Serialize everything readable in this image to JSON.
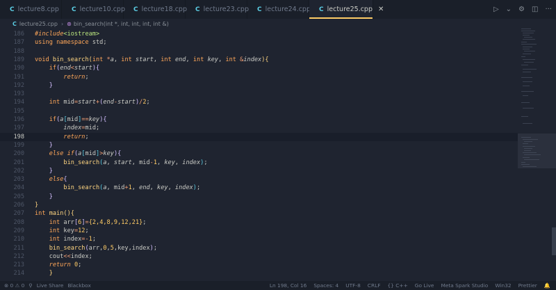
{
  "tabs": [
    {
      "label": "lecture8.cpp",
      "icon": "C"
    },
    {
      "label": "lecture10.cpp",
      "icon": "C"
    },
    {
      "label": "lecture18.cpp",
      "icon": "C"
    },
    {
      "label": "lecture23.cpp",
      "icon": "C"
    },
    {
      "label": "lecture24.cpp",
      "icon": "C"
    },
    {
      "label": "lecture25.cpp",
      "icon": "C",
      "active": true
    }
  ],
  "tab_close": "✕",
  "tab_actions": {
    "run": "▷",
    "run_menu": "⌄",
    "settings": "⚙",
    "split": "◫",
    "more": "···"
  },
  "breadcrumb": {
    "file": "lecture25.cpp",
    "symbol": "bin_search(int *, int, int, int, int &)"
  },
  "editor": {
    "current_line": 198,
    "lines": [
      {
        "n": "186"
      },
      {
        "n": "187"
      },
      {
        "n": "188"
      },
      {
        "n": "189"
      },
      {
        "n": "190"
      },
      {
        "n": "191"
      },
      {
        "n": "192"
      },
      {
        "n": "193"
      },
      {
        "n": "194"
      },
      {
        "n": "195"
      },
      {
        "n": "196"
      },
      {
        "n": "197"
      },
      {
        "n": "198"
      },
      {
        "n": "199"
      },
      {
        "n": "200"
      },
      {
        "n": "201"
      },
      {
        "n": "202"
      },
      {
        "n": "203"
      },
      {
        "n": "204"
      },
      {
        "n": "205"
      },
      {
        "n": "206"
      },
      {
        "n": "207"
      },
      {
        "n": "208"
      },
      {
        "n": "209"
      },
      {
        "n": "210"
      },
      {
        "n": "211"
      },
      {
        "n": "212"
      },
      {
        "n": "213"
      },
      {
        "n": "214"
      }
    ],
    "tokens": {
      "include": "#include",
      "iostream": "<iostream>",
      "using": "using",
      "namespace": "namespace",
      "std": "std;",
      "void": "void",
      "bin_search": "bin_search",
      "int": "int",
      "if": "if",
      "else": "else",
      "return": "return",
      "main": "main",
      "cout": "cout",
      "zero": "0",
      "one": "1",
      "two": "2",
      "five": "5",
      "six": "6",
      "twelve": "12",
      "arr_init": "{2,4,8,9,12,21}"
    }
  },
  "statusbar": {
    "left": [
      "⊗ 0 ⚠ 0",
      "⚲",
      "Live Share",
      "Blackbox"
    ],
    "right": [
      "Ln 198, Col 16",
      "Spaces: 4",
      "UTF-8",
      "CRLF",
      "{} C++",
      "Go Live",
      "Meta Spark Studio",
      "Win32",
      "Prettier",
      "🔔"
    ]
  }
}
